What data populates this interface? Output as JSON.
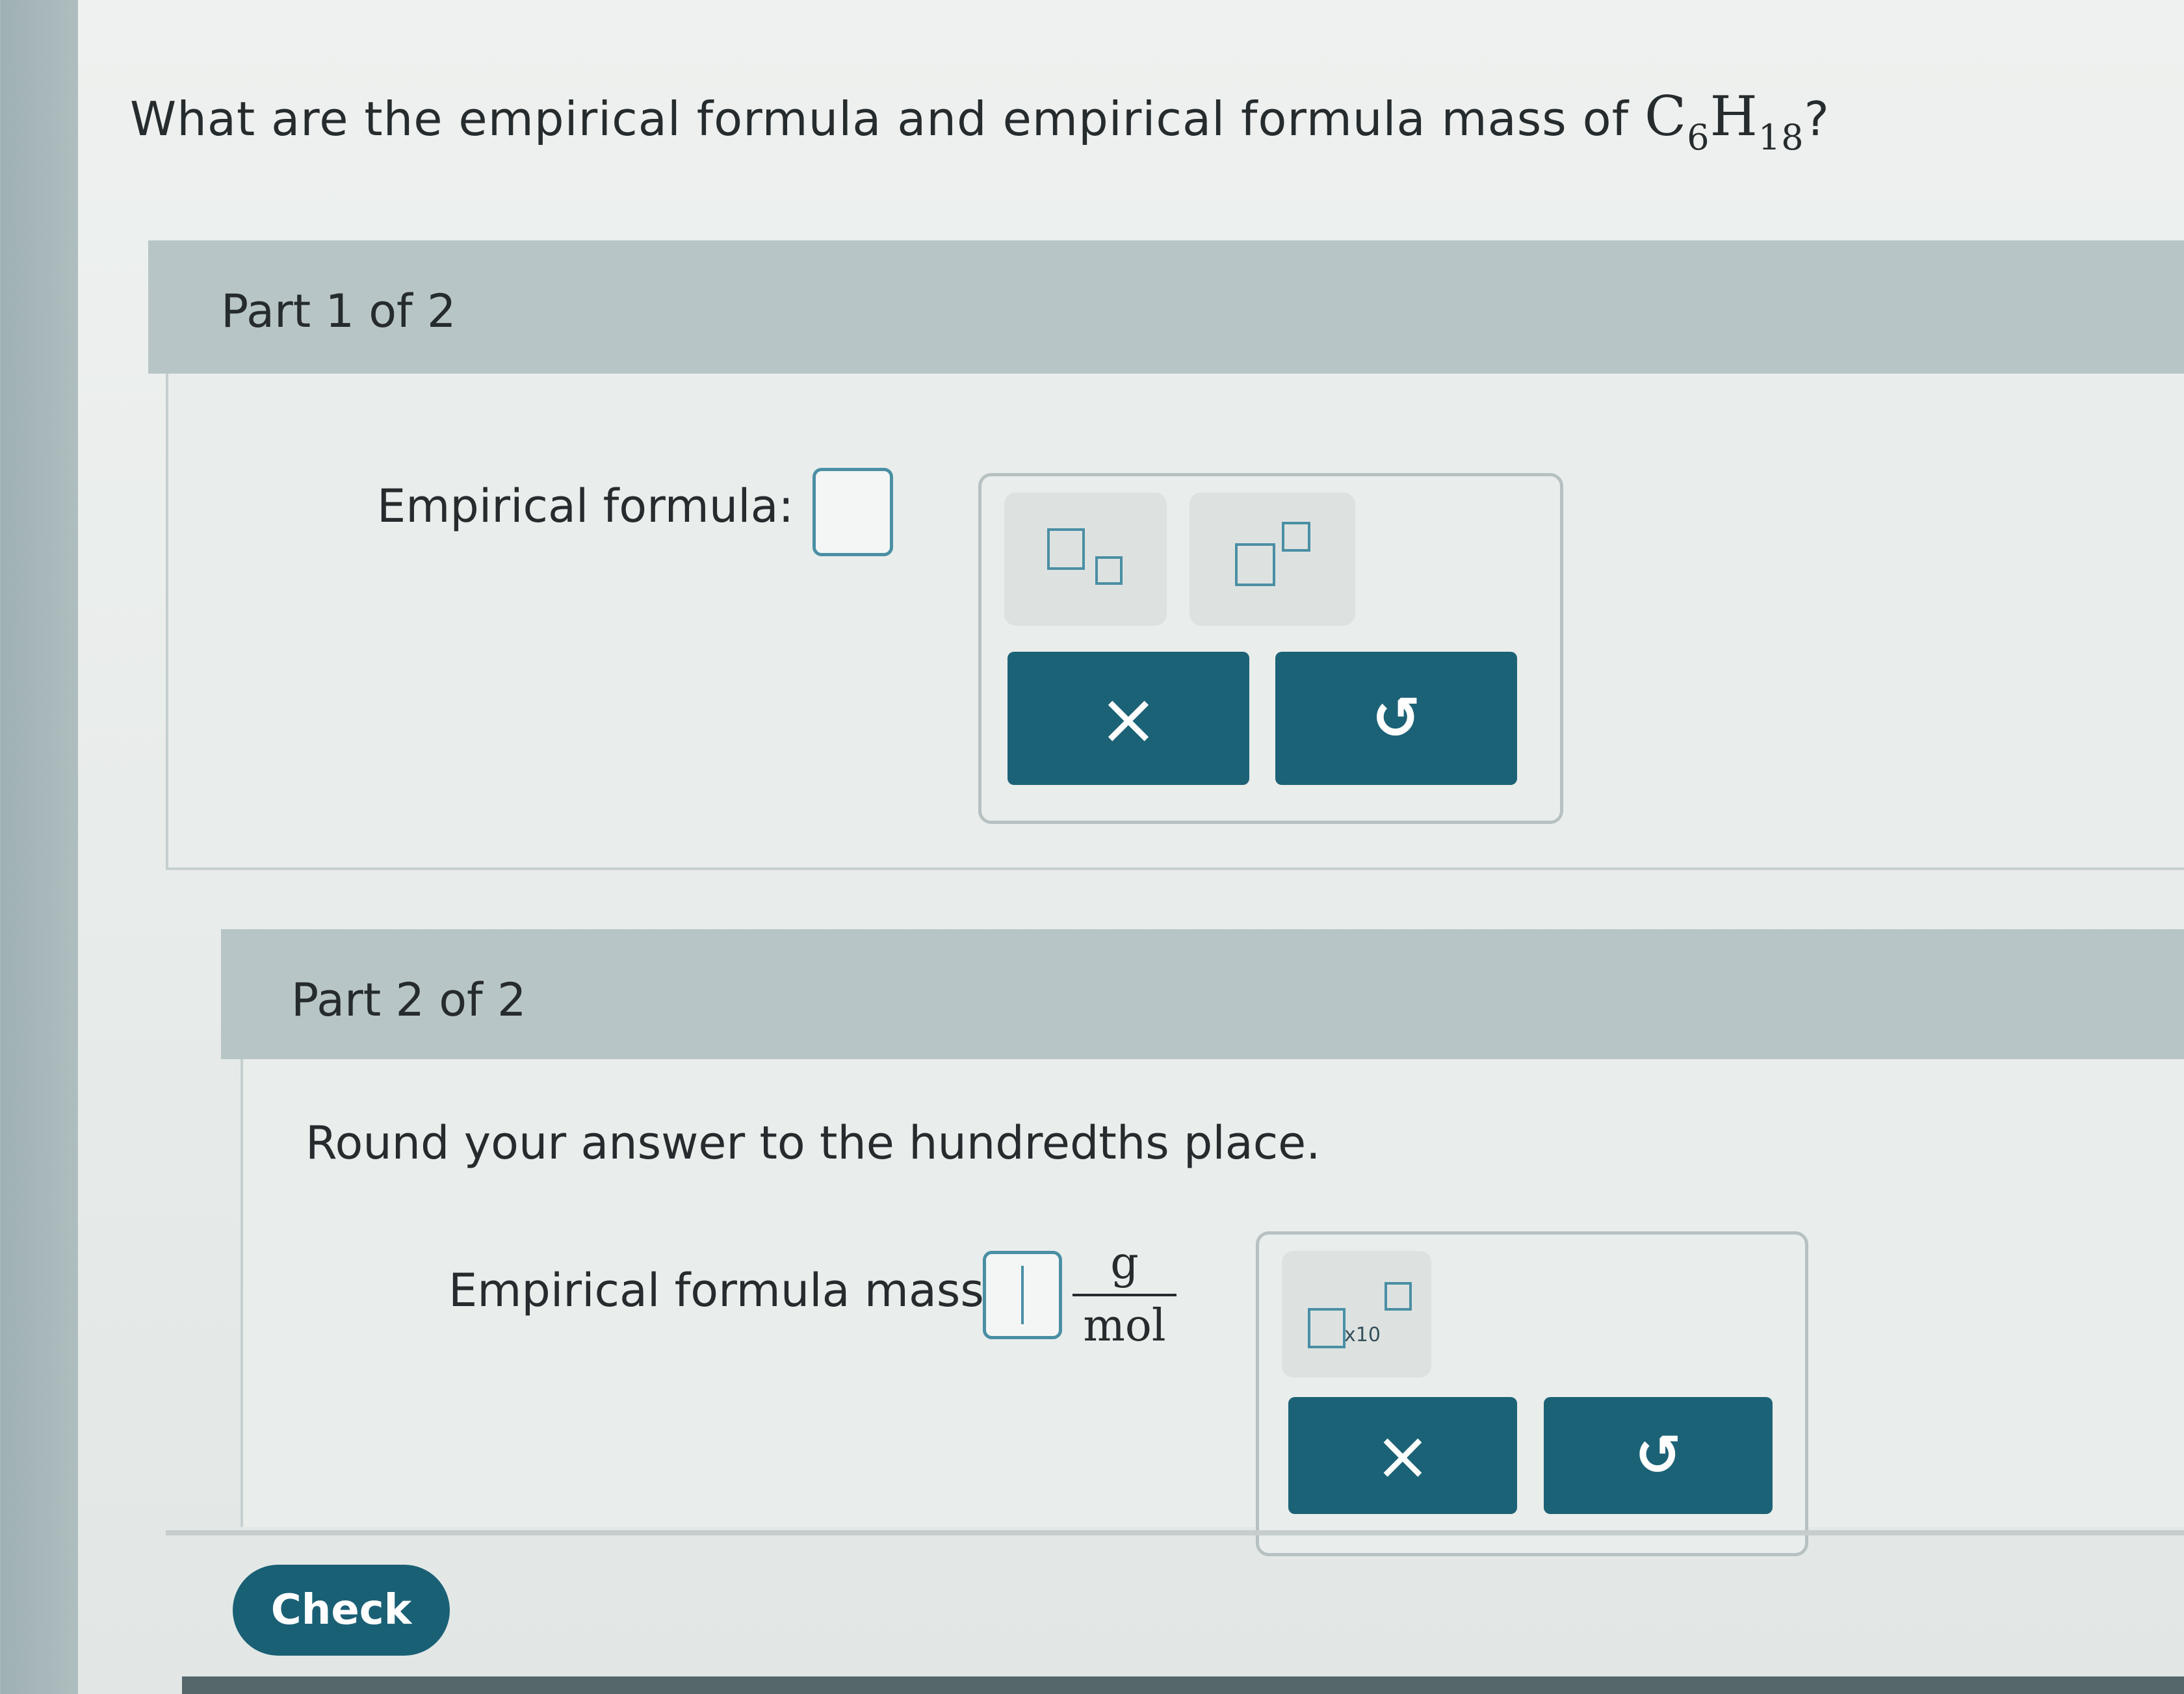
{
  "question": {
    "prefix": "What are the empirical formula and empirical formula mass of ",
    "formula": {
      "element1": "C",
      "count1": "6",
      "element2": "H",
      "count2": "18"
    },
    "suffix": "?"
  },
  "part1": {
    "header": "Part 1 of 2",
    "label": "Empirical formula:",
    "answer_value": "",
    "tools": [
      "subscript-template-icon",
      "superscript-template-icon"
    ],
    "buttons": {
      "clear": "×",
      "undo": "↺"
    }
  },
  "part2": {
    "header": "Part 2 of 2",
    "instruction": "Round your answer to the hundredths place.",
    "label": "Empirical formula mass:",
    "answer_value": "",
    "unit_numerator": "g",
    "unit_denominator": "mol",
    "tools": [
      "scientific-notation-icon"
    ],
    "x10_label": "x10",
    "buttons": {
      "clear": "×",
      "undo": "↺"
    }
  },
  "footer": {
    "check_label": "Check"
  },
  "colors": {
    "accent": "#1c6277",
    "input_border": "#4a8fa4",
    "header_bg": "#b8c5c6"
  }
}
